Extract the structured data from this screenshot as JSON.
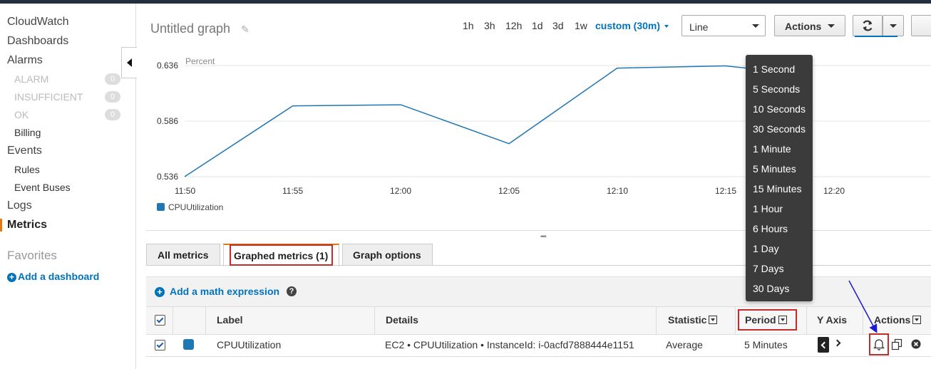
{
  "sidebar": {
    "cloudwatch": "CloudWatch",
    "dashboards": "Dashboards",
    "alarms": "Alarms",
    "alarm_states": [
      {
        "label": "ALARM",
        "count": "0"
      },
      {
        "label": "INSUFFICIENT",
        "count": "0"
      },
      {
        "label": "OK",
        "count": "0"
      }
    ],
    "billing": "Billing",
    "events": "Events",
    "rules": "Rules",
    "event_buses": "Event Buses",
    "logs": "Logs",
    "metrics": "Metrics",
    "favorites": "Favorites",
    "add_dashboard": "Add a dashboard"
  },
  "header": {
    "title": "Untitled graph",
    "ranges": [
      "1h",
      "3h",
      "12h",
      "1d",
      "3d",
      "1w"
    ],
    "custom_range": "custom (30m)",
    "view_select": "Line",
    "actions_label": "Actions"
  },
  "chart_data": {
    "type": "line",
    "ylabel": "Percent",
    "x": [
      "11:50",
      "11:55",
      "12:00",
      "12:05",
      "12:10",
      "12:15",
      "12:20"
    ],
    "y_ticks": [
      "0.636",
      "0.586",
      "0.536"
    ],
    "ylim": [
      0.536,
      0.636
    ],
    "grid": true,
    "legend_position": "bottom-left",
    "series": [
      {
        "name": "CPUUtilization",
        "color": "#1f77b4",
        "points": [
          {
            "t": "11:50",
            "v": 0.536
          },
          {
            "t": "11:55",
            "v": 0.5997
          },
          {
            "t": "12:00",
            "v": 0.6007
          },
          {
            "t": "12:05",
            "v": 0.5657
          },
          {
            "t": "12:10",
            "v": 0.6337
          },
          {
            "t": "12:15",
            "v": 0.6357
          },
          {
            "t": "12:19",
            "v": 0.6277
          }
        ]
      }
    ]
  },
  "tabs": [
    "All metrics",
    "Graphed metrics (1)",
    "Graph options"
  ],
  "math_expression": "Add a math expression",
  "help_symbol": "?",
  "table": {
    "headers": {
      "label": "Label",
      "details": "Details",
      "statistic": "Statistic",
      "period": "Period",
      "yaxis": "Y Axis",
      "actions": "Actions"
    },
    "row": {
      "label": "CPUUtilization",
      "details": "EC2 • CPUUtilization • InstanceId: i-0acfd7888444e1151",
      "statistic": "Average",
      "period": "5 Minutes"
    }
  },
  "period_options": [
    "1 Second",
    "5 Seconds",
    "10 Seconds",
    "30 Seconds",
    "1 Minute",
    "5 Minutes",
    "15 Minutes",
    "1 Hour",
    "6 Hours",
    "1 Day",
    "7 Days",
    "30 Days"
  ],
  "colors": {
    "accent": "#0073bb",
    "series": "#1f77b4",
    "active_tab": "#e47911",
    "highlight_box": "#c42b2b",
    "annotation_arrow": "#1a1ad6"
  }
}
